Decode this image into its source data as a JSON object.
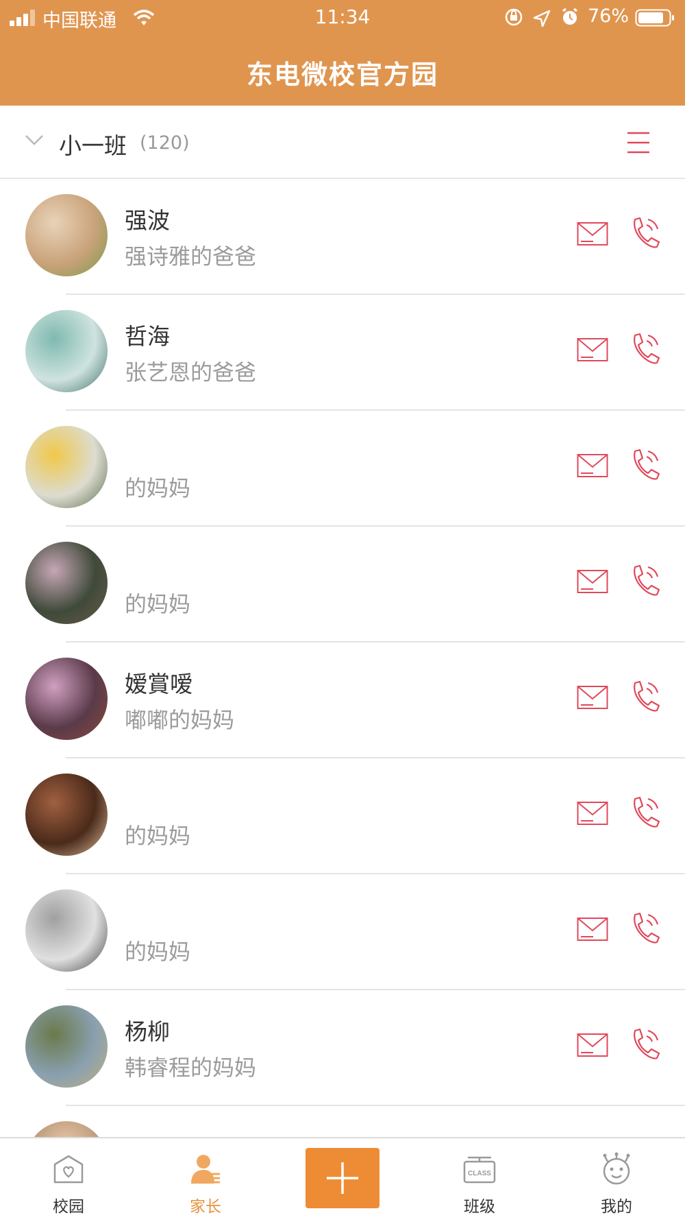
{
  "status_bar": {
    "carrier": "中国联通",
    "time": "11:34",
    "battery": "76%"
  },
  "header": {
    "title": "东电微校官方园"
  },
  "class_selector": {
    "name": "小一班",
    "count": "(120)"
  },
  "parents": [
    {
      "name": "强波",
      "relation": "强诗雅的爸爸",
      "avatar_colors": [
        "#c9a27a",
        "#e8d3b8",
        "#7a9a4a"
      ]
    },
    {
      "name": "哲海",
      "relation": "张艺恩的爸爸",
      "avatar_colors": [
        "#cfe3df",
        "#7fb9b0",
        "#3f6f6a"
      ]
    },
    {
      "name": "",
      "relation": "的妈妈",
      "avatar_colors": [
        "#dcdcd0",
        "#f0c84a",
        "#5a6a4a"
      ]
    },
    {
      "name": "",
      "relation": "的妈妈",
      "avatar_colors": [
        "#3f4a3a",
        "#c7a7b6",
        "#6b5a4a"
      ]
    },
    {
      "name": "嫒賞嗳",
      "relation": "嘟嘟的妈妈",
      "avatar_colors": [
        "#5a3a4a",
        "#d0a0c0",
        "#8a4a3a"
      ]
    },
    {
      "name": "",
      "relation": "的妈妈",
      "avatar_colors": [
        "#4a2a1a",
        "#a06040",
        "#e0c0a0"
      ]
    },
    {
      "name": "",
      "relation": "的妈妈",
      "avatar_colors": [
        "#e0e0e0",
        "#a0a0a0",
        "#404040"
      ]
    },
    {
      "name": "杨柳",
      "relation": "韩睿程的妈妈",
      "avatar_colors": [
        "#8aa0b0",
        "#6a7a4a",
        "#c0b080"
      ]
    }
  ],
  "tabs": [
    {
      "label": "校园",
      "icon": "school-icon"
    },
    {
      "label": "家长",
      "icon": "parent-icon"
    },
    {
      "label": "",
      "icon": "plus-icon"
    },
    {
      "label": "班级",
      "icon": "class-icon"
    },
    {
      "label": "我的",
      "icon": "profile-icon"
    }
  ],
  "colors": {
    "header_bg": "#e0954f",
    "accent": "#e8923c",
    "icon_red": "#e0485a"
  }
}
